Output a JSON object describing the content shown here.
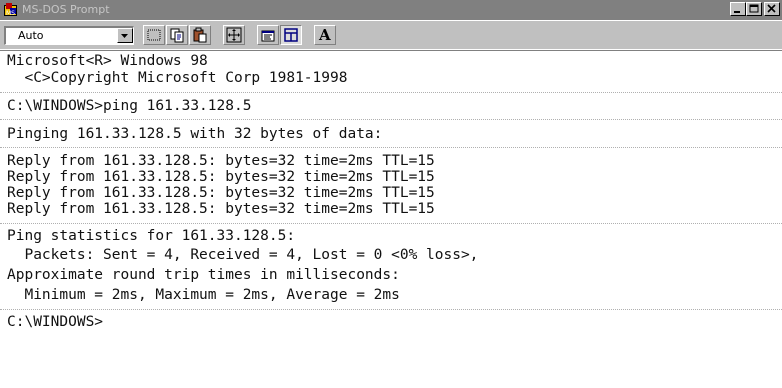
{
  "window": {
    "title": "MS-DOS Prompt",
    "controls": [
      "minimize",
      "maximize",
      "close"
    ]
  },
  "toolbar": {
    "font_size_value": "Auto",
    "buttons": [
      "mark-icon",
      "copy-icon",
      "paste-icon",
      "full-screen-icon",
      "properties-icon",
      "background-icon",
      "font-icon"
    ],
    "font_button_label": "A"
  },
  "console": {
    "lines": [
      "Microsoft<R> Windows 98",
      "  <C>Copyright Microsoft Corp 1981-1998",
      "C:\\WINDOWS>ping 161.33.128.5",
      "Pinging 161.33.128.5 with 32 bytes of data:",
      "Reply from 161.33.128.5: bytes=32 time=2ms TTL=15",
      "Reply from 161.33.128.5: bytes=32 time=2ms TTL=15",
      "Reply from 161.33.128.5: bytes=32 time=2ms TTL=15",
      "Reply from 161.33.128.5: bytes=32 time=2ms TTL=15",
      "Ping statistics for 161.33.128.5:",
      "  Packets: Sent = 4, Received = 4, Lost = 0 <0% loss>,",
      "Approximate round trip times in milliseconds:",
      "  Minimum = 2ms, Maximum = 2ms, Average = 2ms",
      "C:\\WINDOWS>"
    ]
  },
  "colors": {
    "titlebar": "#808080",
    "title_text": "#c6c6c6",
    "face": "#c0c0c0",
    "console_bg": "#ffffff",
    "console_text": "#111111"
  }
}
